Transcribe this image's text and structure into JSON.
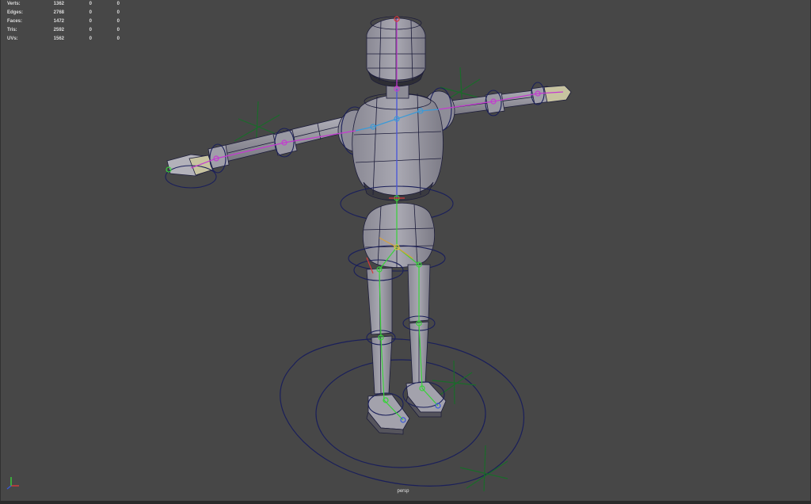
{
  "viewport": {
    "camera": "persp",
    "background": "#474747"
  },
  "hud": {
    "rows": [
      {
        "label": "Verts:",
        "total": "1362",
        "selected": "0",
        "component": "0"
      },
      {
        "label": "Edges:",
        "total": "2768",
        "selected": "0",
        "component": "0"
      },
      {
        "label": "Faces:",
        "total": "1472",
        "selected": "0",
        "component": "0"
      },
      {
        "label": "Tris:",
        "total": "2592",
        "selected": "0",
        "component": "0"
      },
      {
        "label": "UVs:",
        "total": "1562",
        "selected": "0",
        "component": "0"
      }
    ]
  },
  "colors": {
    "mesh_fill": "#9a99a3",
    "mesh_shadow": "#6e6d76",
    "wire": "#1c1c3a",
    "rig_control": "#1a1f5a",
    "locator": "#1a6b2a",
    "joint_blue": "#3a9ad8",
    "joint_green": "#38d23a",
    "joint_magenta": "#c43ad0",
    "joint_yellow": "#d8c83a",
    "joint_red": "#d83a3a"
  },
  "axis_indicator": {
    "x": "red",
    "y": "green",
    "z": "blue"
  }
}
